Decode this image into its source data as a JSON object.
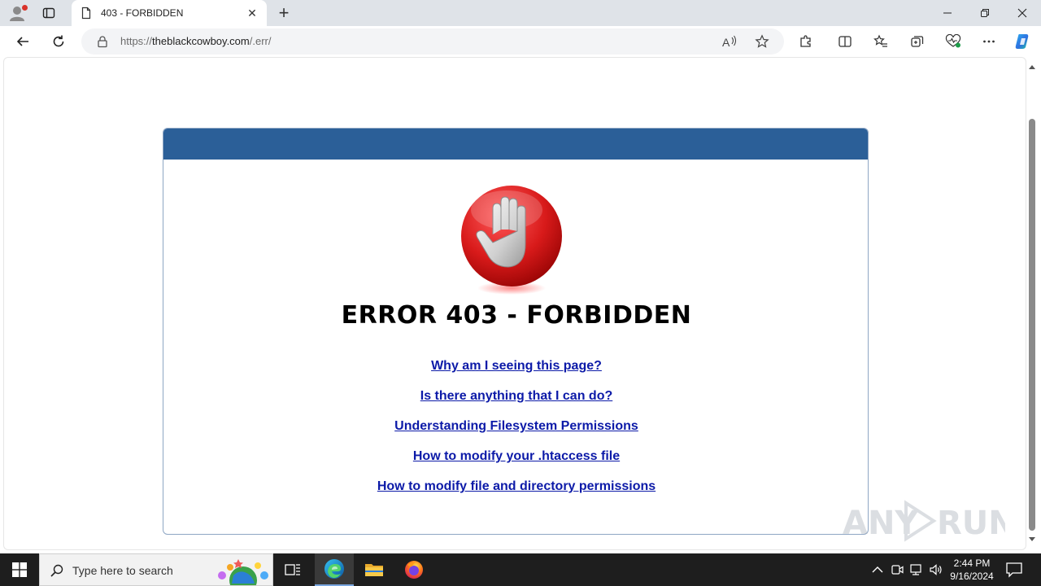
{
  "browser": {
    "tab_title": "403 - FORBIDDEN",
    "url_scheme": "https://",
    "url_host": "theblackcowboy.com",
    "url_path": "/.err/"
  },
  "page": {
    "error_title": "ERROR 403 - FORBIDDEN",
    "links": [
      "Why am I seeing this page?",
      "Is there anything that I can do?",
      "Understanding Filesystem Permissions",
      "How to modify your .htaccess file",
      "How to modify file and directory permissions"
    ],
    "header_color": "#2b5f98",
    "link_color": "#0c1aa8"
  },
  "watermark": {
    "text": "ANY RUN"
  },
  "taskbar": {
    "search_placeholder": "Type here to search",
    "time": "2:44 PM",
    "date": "9/16/2024"
  }
}
